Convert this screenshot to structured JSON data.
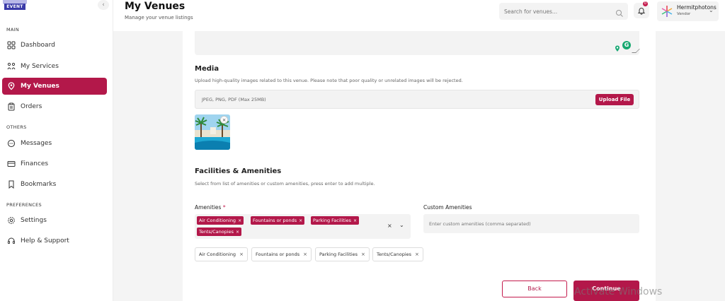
{
  "brand": {
    "logo_text_top": "EVENT",
    "logo_text": "EVENT"
  },
  "sidebar": {
    "collapse_icon": "chevron-left-icon",
    "sections": {
      "main": "MAIN",
      "others": "OTHERS",
      "preferences": "PREFERENCES"
    },
    "items": [
      {
        "label": "Dashboard",
        "icon": "grid-icon"
      },
      {
        "label": "My Services",
        "icon": "services-icon"
      },
      {
        "label": "My Venues",
        "icon": "location-pin-icon",
        "active": true
      },
      {
        "label": "Orders",
        "icon": "clipboard-icon"
      },
      {
        "label": "Messages",
        "icon": "chat-icon"
      },
      {
        "label": "Finances",
        "icon": "card-icon"
      },
      {
        "label": "Bookmarks",
        "icon": "bookmark-icon"
      },
      {
        "label": "Settings",
        "icon": "gear-icon"
      },
      {
        "label": "Help & Support",
        "icon": "headset-icon"
      }
    ]
  },
  "header": {
    "title": "My Venues",
    "subtitle": "Manage your venue listings",
    "search_placeholder": "Search for venues...",
    "notification_count": "0",
    "user_name": "Hermitphotons",
    "user_role": "Vendor"
  },
  "form": {
    "media_heading": "Media",
    "media_desc": "Upload high-quality images related to this venue. Please note that poor quality or unrelated images will be rejected.",
    "upload_hint": "JPEG, PNG, PDF (Max 25MB)",
    "upload_button": "Upload File",
    "thumb_remove": "×",
    "facilities_heading": "Facilities & Amenities",
    "facilities_desc": "Select from list of amenities or custom amenities, press enter to add multiple.",
    "amenities_label": "Amenities",
    "required_mark": "*",
    "custom_label": "Custom Amenities",
    "custom_placeholder": "Enter custom amenities (comma separated)",
    "selected_chips": [
      "Air Conditioning",
      "Fountains or ponds",
      "Parking Facilities",
      "Tents/Canopies"
    ],
    "tags": [
      "Air Conditioning",
      "Fountains or ponds",
      "Parking Facilities",
      "Tents/Canopies"
    ],
    "remove_glyph": "×",
    "clear_glyph": "×",
    "dropdown_glyph": "⌄",
    "back_button": "Back",
    "continue_button": "Continue"
  },
  "watermark": "Activate Windows",
  "colors": {
    "accent": "#b3184a",
    "background": "#f4f4f4"
  }
}
